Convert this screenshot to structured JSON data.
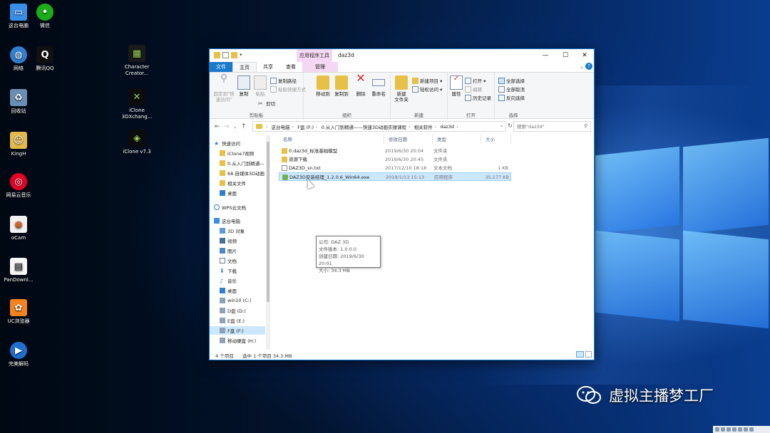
{
  "desktop": {
    "icons": [
      {
        "label": "这台电脑",
        "icon": "computer-icon",
        "color": "#3a8ee6"
      },
      {
        "label": "微信",
        "icon": "wechat-icon",
        "color": "#1aad19"
      },
      {
        "label": "网络",
        "icon": "network-icon",
        "color": "#2f7fd1"
      },
      {
        "label": "腾讯QQ",
        "icon": "qq-icon",
        "color": "#111111"
      },
      {
        "label": "Character\nCreator...",
        "icon": "character-creator-icon",
        "color": "#1a1a1a"
      },
      {
        "label": "回收站",
        "icon": "recycle-bin-icon",
        "color": "#6b8fb3"
      },
      {
        "label": "iClone\n3DXchang...",
        "icon": "iclone-3dxchange-icon",
        "color": "#0c0c0c"
      },
      {
        "label": "KingH",
        "icon": "user-folder-icon",
        "color": "#e3b94c"
      },
      {
        "label": "iClone v7.3",
        "icon": "iclone-icon",
        "color": "#0c0c0c"
      },
      {
        "label": "网易云音乐",
        "icon": "netease-music-icon",
        "color": "#e60026"
      },
      {
        "label": "oCam",
        "icon": "ocam-icon",
        "color": "#f2f2f2"
      },
      {
        "label": "PanDownl...",
        "icon": "pandownload-icon",
        "color": "#f7f7f7"
      },
      {
        "label": "UC浏览器",
        "icon": "uc-browser-icon",
        "color": "#f58220"
      },
      {
        "label": "完美解码",
        "icon": "perfect-decoder-icon",
        "color": "#1f6fd1"
      }
    ]
  },
  "window": {
    "context_tab_title": "应用程序工具",
    "title": "daz3d",
    "minimize": "—",
    "maximize": "☐",
    "close": "✕",
    "tabs": {
      "file": "文件",
      "home": "主页",
      "share": "共享",
      "view": "查看",
      "manage": "管理"
    },
    "ribbon": {
      "clipboard": {
        "pin": "固定到\"快\n速访问\"",
        "copy": "复制",
        "paste": "粘贴",
        "copy_path": "复制路径",
        "paste_shortcut": "粘贴快捷方式",
        "cut": "剪切",
        "group": "剪贴板"
      },
      "organize": {
        "move_to": "移动到",
        "copy_to": "复制到",
        "delete": "删除",
        "rename": "重命名",
        "group": "组织"
      },
      "new": {
        "new_folder": "新建\n文件夹",
        "new_item": "新建项目 ▾",
        "easy_access": "轻松访问 ▾",
        "group": "新建"
      },
      "open": {
        "properties": "属性",
        "open": "打开 ▾",
        "edit": "编辑",
        "history": "历史记录",
        "group": "打开"
      },
      "select": {
        "select_all": "全部选择",
        "select_none": "全部取消",
        "invert": "反向选择",
        "group": "选择"
      }
    },
    "address": {
      "crumbs": [
        "这台电脑",
        "F盘 (F:)",
        "0.从入门到精通——快速3D动画实操课程",
        "相关软件",
        "daz3d"
      ],
      "search_placeholder": "搜索\"daz3d\""
    },
    "nav": [
      {
        "label": "快速访问",
        "icon": "star-icon",
        "indent": 6,
        "selected": false
      },
      {
        "label": "iClone7视频",
        "icon": "folder-icon",
        "indent": 14,
        "selected": false
      },
      {
        "label": "0.从入门到精通—",
        "icon": "folder-icon",
        "indent": 14,
        "selected": false
      },
      {
        "label": "68.自媒体3D动画",
        "icon": "folder-icon",
        "indent": 14,
        "selected": false
      },
      {
        "label": "相关文件",
        "icon": "folder-icon",
        "indent": 14,
        "selected": false
      },
      {
        "label": "桌面",
        "icon": "desktop-icon",
        "indent": 14,
        "selected": false
      },
      {
        "label": "WPS云文档",
        "icon": "cloud-icon",
        "indent": 6,
        "selected": false
      },
      {
        "label": "这台电脑",
        "icon": "computer-icon",
        "indent": 6,
        "selected": false
      },
      {
        "label": "3D 对象",
        "icon": "3d-objects-icon",
        "indent": 14,
        "selected": false
      },
      {
        "label": "视频",
        "icon": "video-icon",
        "indent": 14,
        "selected": false
      },
      {
        "label": "图片",
        "icon": "pictures-icon",
        "indent": 14,
        "selected": false
      },
      {
        "label": "文档",
        "icon": "documents-icon",
        "indent": 14,
        "selected": false
      },
      {
        "label": "下载",
        "icon": "download-icon",
        "indent": 14,
        "selected": false
      },
      {
        "label": "音乐",
        "icon": "music-icon",
        "indent": 14,
        "selected": false
      },
      {
        "label": "桌面",
        "icon": "desktop-icon",
        "indent": 14,
        "selected": false
      },
      {
        "label": "win10 (C:)",
        "icon": "drive-icon",
        "indent": 14,
        "selected": false
      },
      {
        "label": "D盘 (D:)",
        "icon": "drive-icon",
        "indent": 14,
        "selected": false
      },
      {
        "label": "E盘 (E:)",
        "icon": "drive-icon",
        "indent": 14,
        "selected": false
      },
      {
        "label": "F盘 (F:)",
        "icon": "drive-icon",
        "indent": 14,
        "selected": true
      },
      {
        "label": "移动硬盘 (H:)",
        "icon": "drive-icon",
        "indent": 14,
        "selected": false
      }
    ],
    "columns": {
      "name": "名称",
      "date": "修改日期",
      "type": "类型",
      "size": "大小"
    },
    "files": [
      {
        "name": "0.daz3d_标准基础模型",
        "date": "2019/6/30 20:04",
        "type": "文件夹",
        "size": "",
        "icon": "folder-icon",
        "selected": false
      },
      {
        "name": "资源下载",
        "date": "2019/6/30 20:45",
        "type": "文件夹",
        "size": "",
        "icon": "folder-icon",
        "selected": false
      },
      {
        "name": "DAZ3D_sn.txt",
        "date": "2017/12/10 18:18",
        "type": "文本文档",
        "size": "1 KB",
        "icon": "text-file-icon",
        "selected": false
      },
      {
        "name": "DAZ3D安装经理_1.2.0.6_Win64.exe",
        "date": "2019/1/13 15:13",
        "type": "应用程序",
        "size": "35,177 KB",
        "icon": "exe-icon",
        "selected": true
      }
    ],
    "tooltip": [
      "公司: DAZ 3D",
      "文件版本: 1.0.0.0",
      "创建日期: 2019/6/30 20:01",
      "大小: 34.3 MB"
    ],
    "status": {
      "count": "4 个项目",
      "selection": "选中 1 个项目 34.3 MB"
    }
  },
  "watermark": "虚拟主播梦工厂",
  "colors": {
    "accent": "#1979ca",
    "selection": "#cce8ff",
    "context_tab": "#f3d7f3",
    "folder": "#e7c048"
  }
}
